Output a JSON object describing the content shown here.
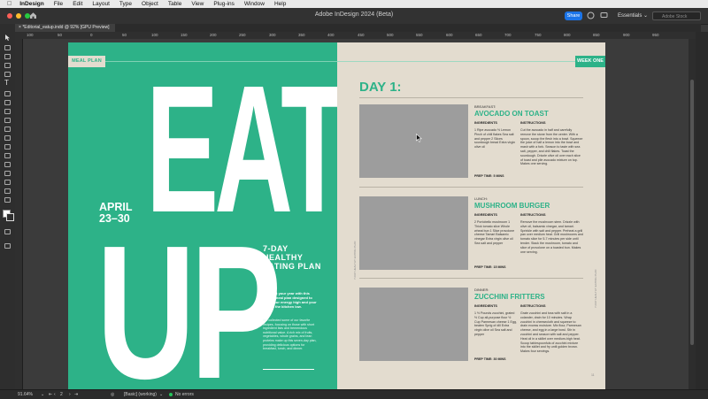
{
  "menubar": {
    "app": "InDesign",
    "items": [
      "File",
      "Edit",
      "Layout",
      "Type",
      "Object",
      "Table",
      "View",
      "Plug-ins",
      "Window",
      "Help"
    ]
  },
  "window": {
    "title": "Adobe InDesign 2024 (Beta)",
    "share_label": "Share",
    "workspace": "Essentials",
    "search_placeholder": "Adobe Stock"
  },
  "document_tab": "*Editorial_eatup.indd @ 92% [GPU Preview]",
  "ruler_ticks": [
    "100",
    "50",
    "0",
    "50",
    "100",
    "150",
    "200",
    "250",
    "300",
    "350",
    "400",
    "450",
    "500",
    "550",
    "600",
    "650",
    "700",
    "750",
    "800",
    "850",
    "900",
    "950"
  ],
  "status": {
    "zoom": "91.64%",
    "page": "2",
    "style": "[Basic] (working)",
    "preflight": "No errors"
  },
  "left_page": {
    "tag": "MEAL PLAN",
    "headline_top": "EAT",
    "headline_bottom": "UP",
    "date_line1": "APRIL",
    "date_line2": "23–30",
    "plan_title": "7-DAY HEALTHY EATING PLAN",
    "intro": "kickstart your year with this simple meal plan designed to keep your energy high and your time in the kitchen low.",
    "body": "We collected some of our favorite recipes, focusing on those with short ingredient lists and tremendous nutritional value. A rich mix of fruits, vegetables, whole grains, and lean proteins make up this seven-day plan, providing delicious options for breakfast, lunch, and dinner.",
    "side_text": "7-DAY HEALTHY EATING PLAN"
  },
  "right_page": {
    "tag": "WEEK ONE",
    "day_heading": "DAY 1:",
    "ingredients_header": "INGREDIENTS",
    "instructions_header": "INSTRUCTIONS",
    "side_text": "7-DAY HEALTHY EATING PLAN",
    "page_number": "11",
    "meals": [
      {
        "label": "BREAKFAST:",
        "name": "AVOCADO ON TOAST",
        "ingredients": "1 Ripe avocado ½ Lemon Pinch of chili flakes Sea salt and pepper 2 Slices sourdough bread Extra virgin olive oil",
        "instructions": "Cut the avocado in half and carefully remove the stone from the center. With a spoon, scoop the flesh into a bowl. Squeeze the juice of half a lemon into the bowl and mash with a fork. Season to taste with sea salt, pepper, and chili flakes. Toast the sourdough. Drizzle olive oil over each slice of toast and pile avocado mixture on top. Makes one serving.",
        "prep": "PREP TIME: 5 MINS"
      },
      {
        "label": "LUNCH:",
        "name": "MUSHROOM BURGER",
        "ingredients": "2 Portobello mushroom 1 Thick tomato slice Whole wheat bun 1 Slice provolone cheese Tamari Balsamic vinegar Extra virgin olive oil Sea salt and pepper",
        "instructions": "Remove the mushroom stem. Drizzle with olive oil, balsamic vinegar, and tamari. Sprinkle with salt and pepper. Preheat a grill pan over medium heat. Grill mushrooms and tomato slice for 5-7 minutes per side until tender. Stack the mushroom, tomato and slice of provolone on a toasted bun. Makes one serving.",
        "prep": "PREP TIME: 15 MINS"
      },
      {
        "label": "DINNER:",
        "name": "ZUCCHINI FRITTERS",
        "ingredients": "1 ½ Pounds zucchini, grated ½ Cup all-purpose flour ½ Cup Parmesan cheese 1 Egg, beaten Sprig of dill Extra virgin olive oil Sea salt and pepper",
        "instructions": "Grate zucchini and toss with salt in a colander, drain for 10 minutes. Wrap zucchini in cheesecloth and squeeze to drain excess moisture. Mix flour, Parmesan cheese, and egg in a large bowl. Stir in zucchini and season with salt and pepper. Heat oil in a skillet over medium-high heat. Scoop tablespoonfuls of zucchini mixture into the skillet and fry until golden brown. Makes four servings.",
        "prep": "PREP TIME: 30 MINS"
      }
    ]
  },
  "colors": {
    "accent_green": "#2db288",
    "page_cream": "#e3dccf",
    "share_blue": "#1b74e8"
  }
}
